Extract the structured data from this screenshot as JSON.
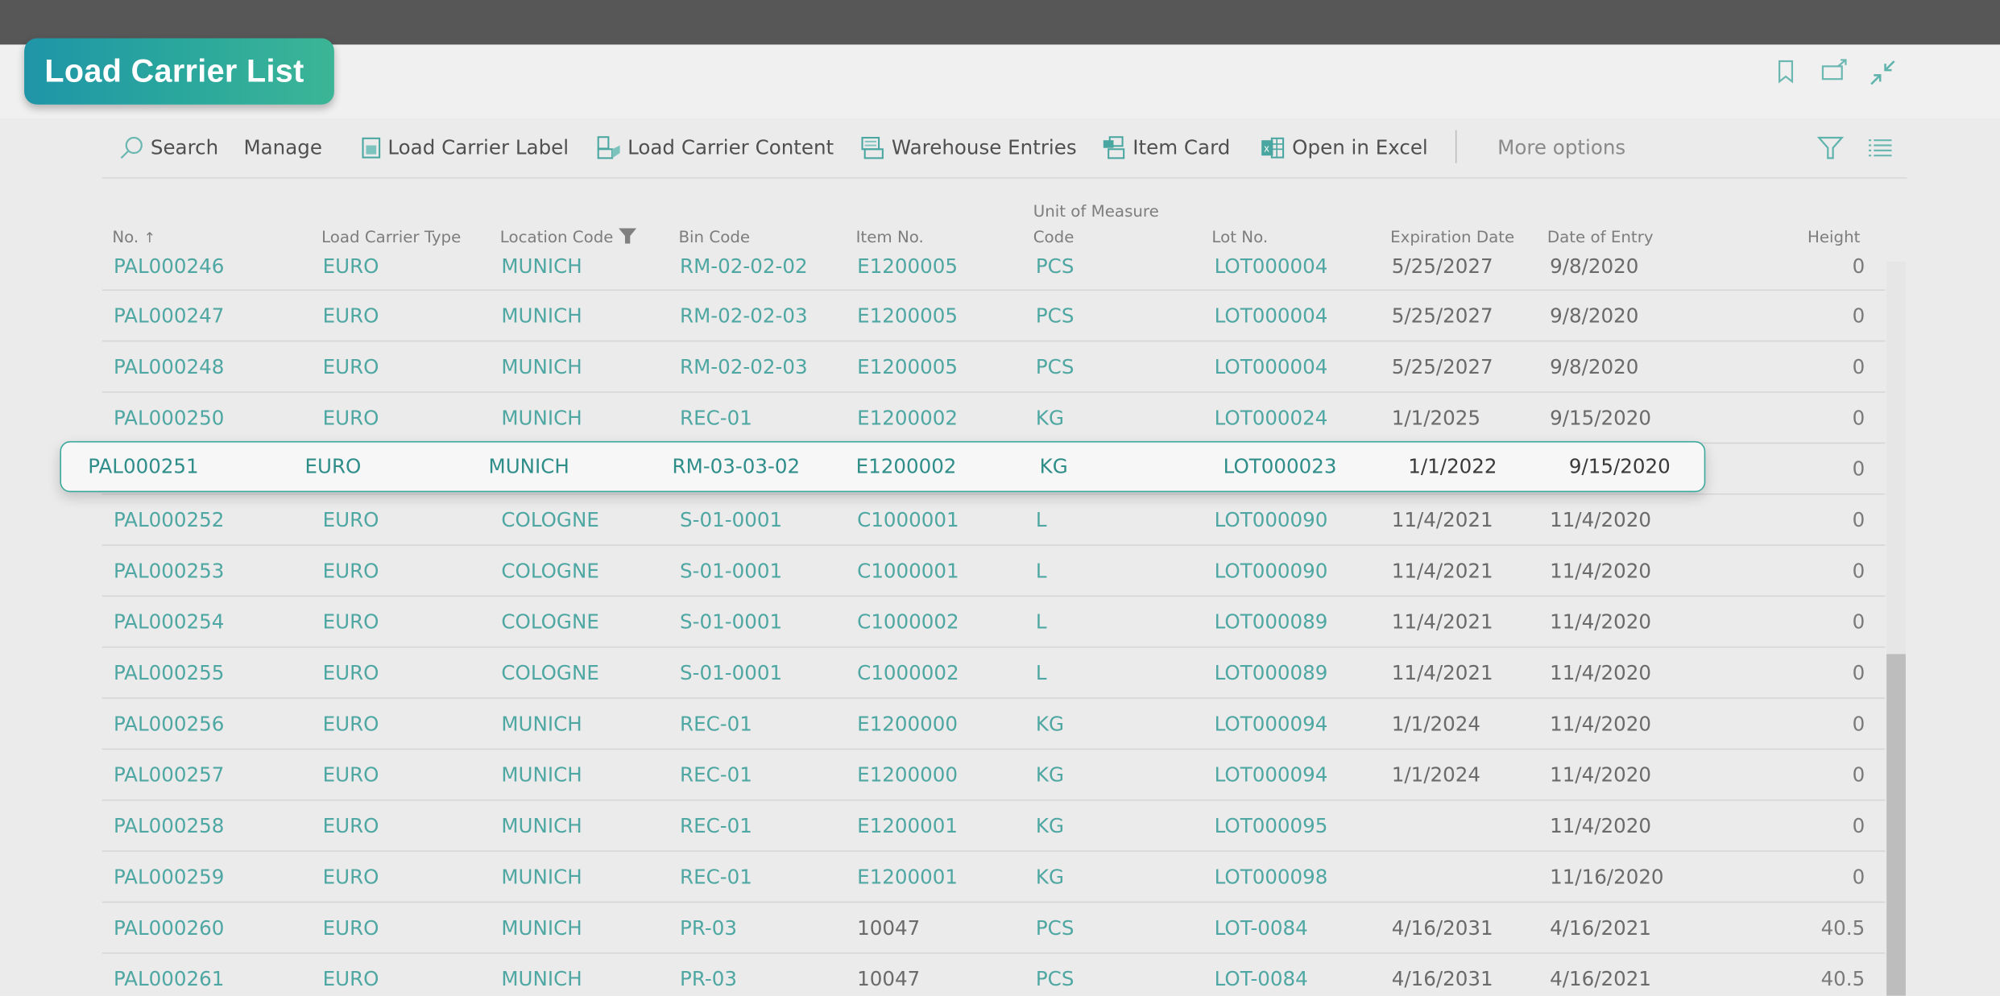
{
  "page": {
    "title": "Load Carrier List"
  },
  "header_actions": [
    {
      "name": "bookmark-icon"
    },
    {
      "name": "open-new-window-icon"
    },
    {
      "name": "collapse-icon"
    }
  ],
  "toolbar": {
    "search_label": "Search",
    "manage_label": "Manage",
    "load_carrier_label": "Load Carrier Label",
    "load_carrier_content": "Load Carrier Content",
    "warehouse_entries": "Warehouse Entries",
    "item_card": "Item Card",
    "open_in_excel": "Open in Excel",
    "more_options": "More options"
  },
  "columns": {
    "no": "No.",
    "no_sort": "↑",
    "load_carrier_type": "Load Carrier Type",
    "location_code": "Location Code",
    "bin_code": "Bin Code",
    "item_no": "Item No.",
    "uom_line1": "Unit of Measure",
    "uom_line2": "Code",
    "lot_no": "Lot No.",
    "expiration_date": "Expiration Date",
    "date_of_entry": "Date of Entry",
    "height": "Height"
  },
  "rows": [
    {
      "no": "PAL000246",
      "type": "EURO",
      "location": "MUNICH",
      "bin": "RM-02-02-02",
      "item": "E1200005",
      "uom": "PCS",
      "lot": "LOT000004",
      "exp": "5/25/2027",
      "entry": "9/8/2020",
      "height": "0"
    },
    {
      "no": "PAL000247",
      "type": "EURO",
      "location": "MUNICH",
      "bin": "RM-02-02-03",
      "item": "E1200005",
      "uom": "PCS",
      "lot": "LOT000004",
      "exp": "5/25/2027",
      "entry": "9/8/2020",
      "height": "0"
    },
    {
      "no": "PAL000248",
      "type": "EURO",
      "location": "MUNICH",
      "bin": "RM-02-02-03",
      "item": "E1200005",
      "uom": "PCS",
      "lot": "LOT000004",
      "exp": "5/25/2027",
      "entry": "9/8/2020",
      "height": "0"
    },
    {
      "no": "PAL000250",
      "type": "EURO",
      "location": "MUNICH",
      "bin": "REC-01",
      "item": "E1200002",
      "uom": "KG",
      "lot": "LOT000024",
      "exp": "1/1/2025",
      "entry": "9/15/2020",
      "height": "0"
    },
    {
      "no": "PAL000251",
      "type": "EURO",
      "location": "MUNICH",
      "bin": "RM-03-03-02",
      "item": "E1200002",
      "uom": "KG",
      "lot": "LOT000023",
      "exp": "1/1/2022",
      "entry": "9/15/2020",
      "height": "0"
    },
    {
      "no": "PAL000252",
      "type": "EURO",
      "location": "COLOGNE",
      "bin": "S-01-0001",
      "item": "C1000001",
      "uom": "L",
      "lot": "LOT000090",
      "exp": "11/4/2021",
      "entry": "11/4/2020",
      "height": "0"
    },
    {
      "no": "PAL000253",
      "type": "EURO",
      "location": "COLOGNE",
      "bin": "S-01-0001",
      "item": "C1000001",
      "uom": "L",
      "lot": "LOT000090",
      "exp": "11/4/2021",
      "entry": "11/4/2020",
      "height": "0"
    },
    {
      "no": "PAL000254",
      "type": "EURO",
      "location": "COLOGNE",
      "bin": "S-01-0001",
      "item": "C1000002",
      "uom": "L",
      "lot": "LOT000089",
      "exp": "11/4/2021",
      "entry": "11/4/2020",
      "height": "0"
    },
    {
      "no": "PAL000255",
      "type": "EURO",
      "location": "COLOGNE",
      "bin": "S-01-0001",
      "item": "C1000002",
      "uom": "L",
      "lot": "LOT000089",
      "exp": "11/4/2021",
      "entry": "11/4/2020",
      "height": "0"
    },
    {
      "no": "PAL000256",
      "type": "EURO",
      "location": "MUNICH",
      "bin": "REC-01",
      "item": "E1200000",
      "uom": "KG",
      "lot": "LOT000094",
      "exp": "1/1/2024",
      "entry": "11/4/2020",
      "height": "0"
    },
    {
      "no": "PAL000257",
      "type": "EURO",
      "location": "MUNICH",
      "bin": "REC-01",
      "item": "E1200000",
      "uom": "KG",
      "lot": "LOT000094",
      "exp": "1/1/2024",
      "entry": "11/4/2020",
      "height": "0"
    },
    {
      "no": "PAL000258",
      "type": "EURO",
      "location": "MUNICH",
      "bin": "REC-01",
      "item": "E1200001",
      "uom": "KG",
      "lot": "LOT000095",
      "exp": "",
      "entry": "11/4/2020",
      "height": "0"
    },
    {
      "no": "PAL000259",
      "type": "EURO",
      "location": "MUNICH",
      "bin": "REC-01",
      "item": "E1200001",
      "uom": "KG",
      "lot": "LOT000098",
      "exp": "",
      "entry": "11/16/2020",
      "height": "0"
    },
    {
      "no": "PAL000260",
      "type": "EURO",
      "location": "MUNICH",
      "bin": "PR-03",
      "item": "10047",
      "uom": "PCS",
      "lot": "LOT-0084",
      "exp": "4/16/2031",
      "entry": "4/16/2021",
      "height": "40.5"
    },
    {
      "no": "PAL000261",
      "type": "EURO",
      "location": "MUNICH",
      "bin": "PR-03",
      "item": "10047",
      "uom": "PCS",
      "lot": "LOT-0084",
      "exp": "4/16/2031",
      "entry": "4/16/2021",
      "height": "40.5"
    }
  ],
  "selected_row_index": 4,
  "colors": {
    "accent": "#3aa89d",
    "link_text": "#4ea7a2",
    "title_gradient_start": "#1f95a8",
    "title_gradient_end": "#3cb596"
  }
}
